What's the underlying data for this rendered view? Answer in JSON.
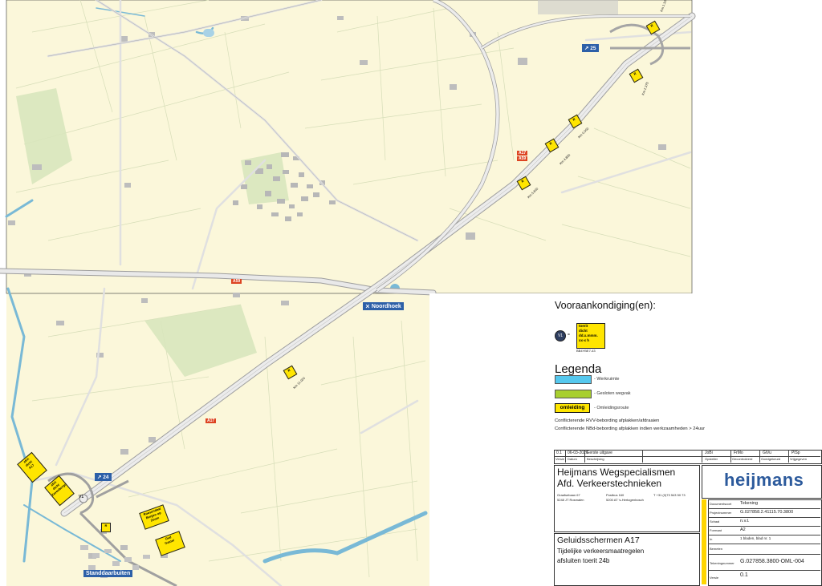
{
  "map": {
    "colors": {
      "land": "#fbf7da",
      "water": "#79b9d6",
      "road": "#e3e3e3",
      "road_edge": "#a9a9a9",
      "built": "#b9b9b9",
      "green": "#c9dcb0"
    },
    "places": {
      "noordhoek": "Noordhoek",
      "standdaarbuiten": "Standdaarbuiten"
    },
    "road_labels": {
      "a17_top": "A17",
      "a59_top": "A59",
      "a59_mid": "A59",
      "a17_low": "A17"
    },
    "exit_numbers": {
      "exit_25": "25",
      "exit_24": "24"
    },
    "sign_small_codes": [
      "Km 1.100",
      "Km 2.375",
      "Km 0.000",
      "Km 4.850",
      "Km 5.600",
      "Km 11.000"
    ],
    "v1_label": "V1",
    "closure_signs": [
      {
        "line1": "afrit",
        "line2": "dicht",
        "line3": "A17"
      },
      {
        "line1": "afrit",
        "line2": "dicht",
        "line3": "Zevenbergen"
      },
      {
        "line1": "Roosendaal",
        "line2": "Bergen op",
        "line3": "Zoom"
      },
      {
        "line1": "Oud",
        "line2": "Gastel",
        "line3": ""
      }
    ]
  },
  "legend": {
    "title": "Vooraankondiging(en):",
    "v1_symbol": "V1",
    "v1_sign_lines": [
      "toerit",
      "dicht",
      "dd.x.mmm.",
      "xx-x h"
    ],
    "v1_code": "BB4YBE7-43",
    "section_title": "Legenda",
    "items": [
      {
        "label": "- Werkruimte",
        "color": "#55c8ee"
      },
      {
        "label": "- Gesloten wegvak",
        "color": "#a8cf2f"
      },
      {
        "label": "- Omleidingsroute",
        "box": "omleiding"
      }
    ],
    "notes": [
      "Conflicterende RVV-bebording afplakken/afdraaien",
      "Conflicterende NBd-bebording afplakken indien werkzaamheden > 24uur"
    ]
  },
  "title_block": {
    "revision_row": {
      "version": "0.1",
      "date": "06-03-2026",
      "description": "Eerste uitgave",
      "opsteller": "JoBi",
      "gecontroleerd": "FrMo",
      "goedgekeurd": "GiVu",
      "vrijgegeven": "PlSp"
    },
    "revision_headers": [
      "Versie",
      "Datum",
      "Beschrijving",
      "Opsteller",
      "Gecontroleerd",
      "Goedgekeurd",
      "Vrijgegeven"
    ],
    "company_line1": "Heijmans Wegspecialismen",
    "company_line2": "Afd. Verkeerstechnieken",
    "address": {
      "street": "Graafsebaan 67",
      "city": "5248 JT Rosmalen",
      "postbus": "Postbus 160",
      "postcity": "5200 AT 's-Hertogenbosch",
      "phone": "T +31 (0)73 543 50 73"
    },
    "logo_text": "heijmans",
    "project_title": "Geluidsschermen A17",
    "subtitle_1": "Tijdelijke verkeersmaatregelen",
    "subtitle_2": "afsluiten toerit 24b",
    "fields": [
      {
        "label": "Documentsoort",
        "value": "Tekening"
      },
      {
        "label": "Projectnummer",
        "value": "G.027858.2.41115.70.3800"
      },
      {
        "label": "Schaal",
        "value": "n.v.t."
      },
      {
        "label": "Formaat",
        "value": "A2"
      },
      {
        "label": "In",
        "value": "1   bladen, blad nr. 1"
      },
      {
        "label": "Bemeten",
        "value": ""
      },
      {
        "label": "Tekeningnummer",
        "value": "G.027858.3800-OML-004"
      },
      {
        "label": "Versie",
        "value": "0.1"
      }
    ]
  }
}
